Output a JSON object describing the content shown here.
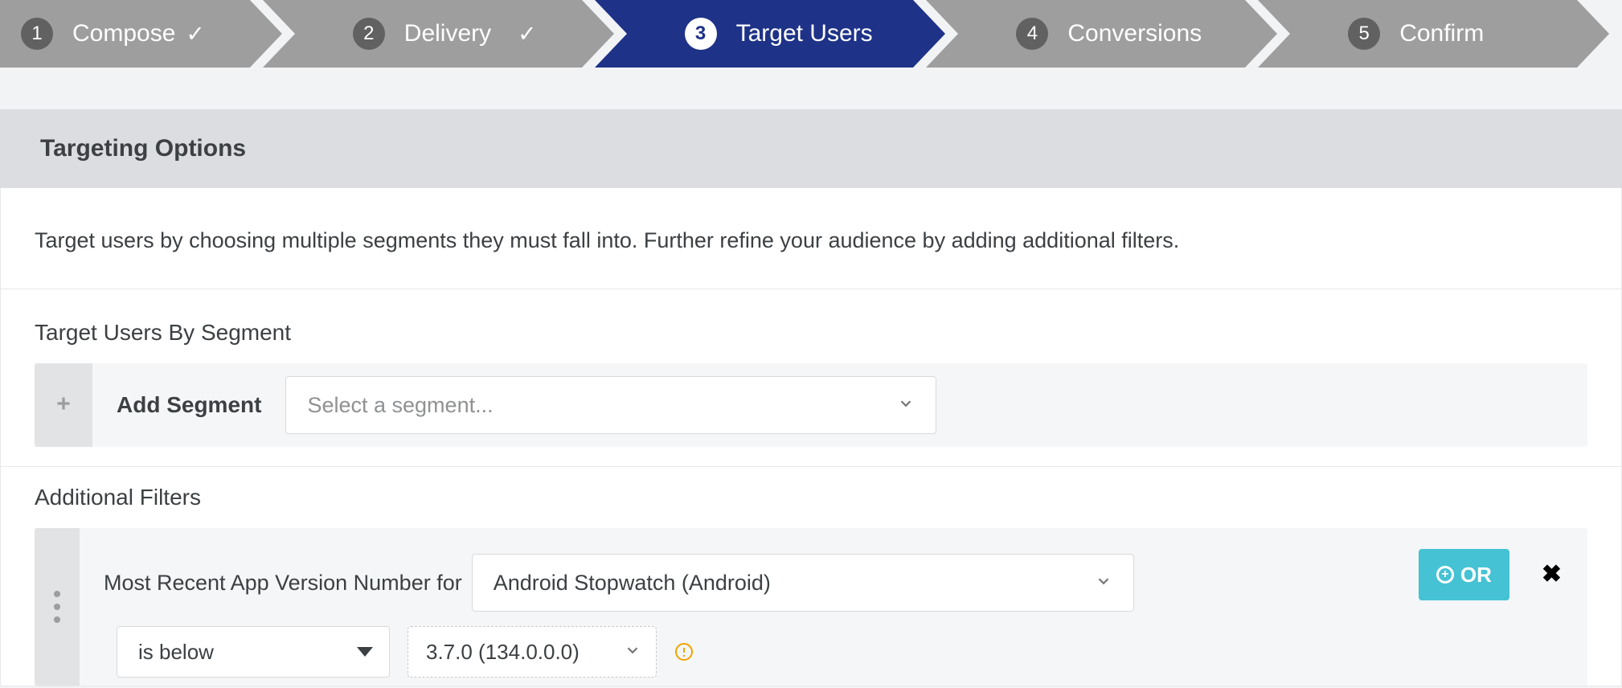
{
  "stepper": {
    "steps": [
      {
        "num": "1",
        "label": "Compose",
        "completed": true
      },
      {
        "num": "2",
        "label": "Delivery",
        "completed": true
      },
      {
        "num": "3",
        "label": "Target Users",
        "completed": false
      },
      {
        "num": "4",
        "label": "Conversions",
        "completed": false
      },
      {
        "num": "5",
        "label": "Confirm",
        "completed": false
      }
    ]
  },
  "panel": {
    "title": "Targeting Options",
    "description": "Target users by choosing multiple segments they must fall into. Further refine your audience by adding additional filters."
  },
  "segments": {
    "heading": "Target Users By Segment",
    "add_label": "Add Segment",
    "select_placeholder": "Select a segment..."
  },
  "filters": {
    "heading": "Additional Filters",
    "row": {
      "prefix_label": "Most Recent App Version Number for",
      "app_value": "Android Stopwatch (Android)",
      "operator_value": "is below",
      "version_value": "3.7.0 (134.0.0.0)"
    },
    "or_label": "OR"
  }
}
